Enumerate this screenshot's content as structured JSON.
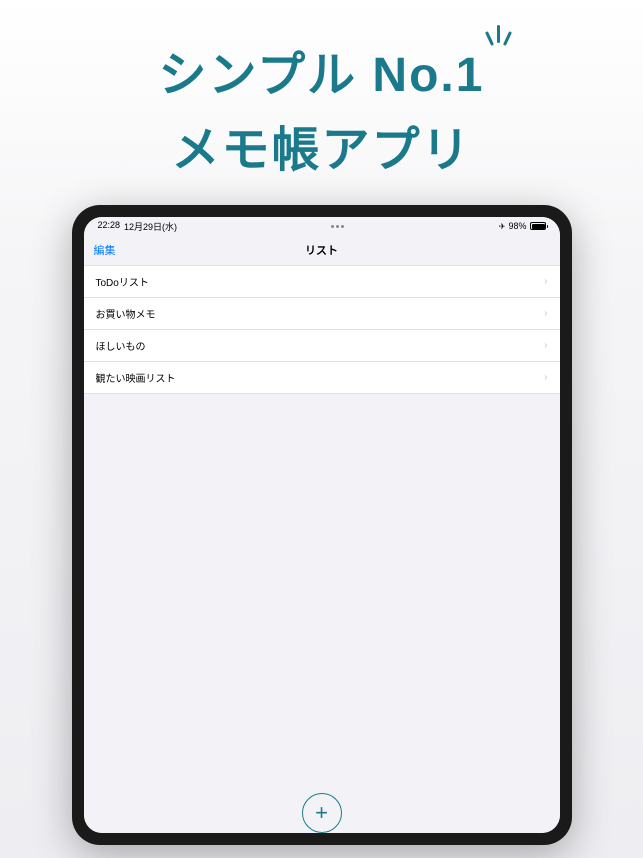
{
  "promo": {
    "line1": "シンプル No.1",
    "line2": "メモ帳アプリ"
  },
  "statusBar": {
    "time": "22:28",
    "date": "12月29日(水)",
    "battery": "98%",
    "airplane": "✈"
  },
  "navBar": {
    "edit": "編集",
    "title": "リスト"
  },
  "listItems": [
    {
      "label": "ToDoリスト"
    },
    {
      "label": "お買い物メモ"
    },
    {
      "label": "ほしいもの"
    },
    {
      "label": "観たい映画リスト"
    }
  ],
  "addButton": {
    "symbol": "+"
  }
}
